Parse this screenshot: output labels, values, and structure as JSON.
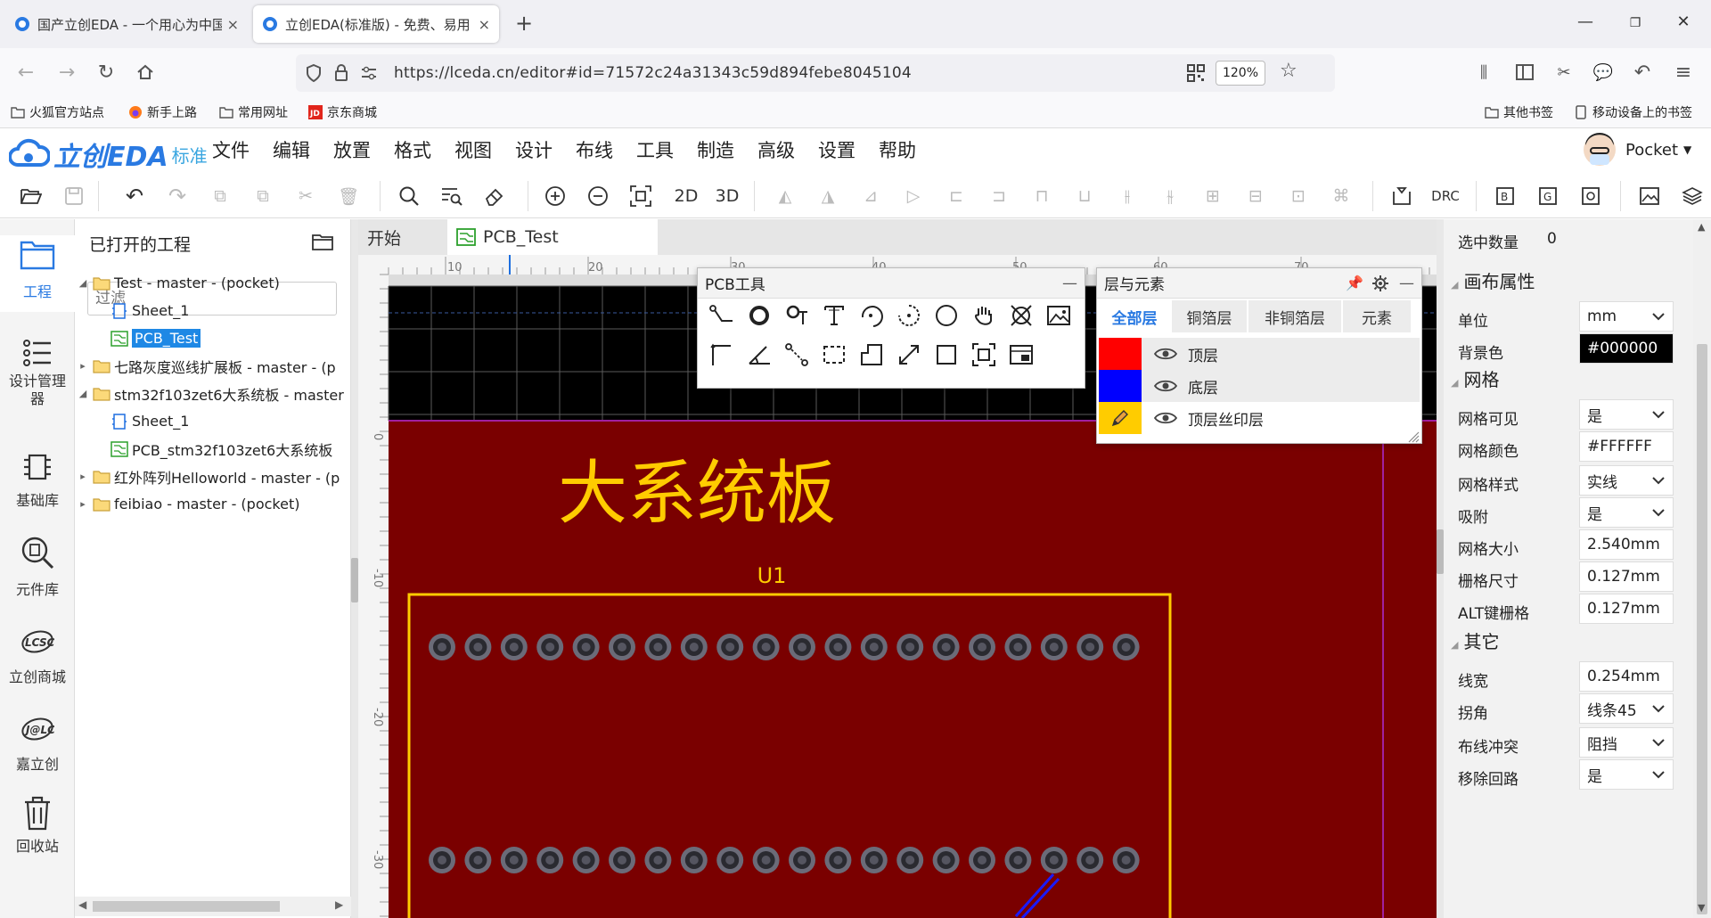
{
  "browser": {
    "tabs": [
      {
        "label": "国产立创EDA - 一个用心为中国",
        "close": "×"
      },
      {
        "label": "立创EDA(标准版) - 免费、易用",
        "close": "×"
      }
    ],
    "new_tab": "+",
    "url": "https://lceda.cn/editor#id=71572c24a31343c59d894febe8045104",
    "zoom": "120%",
    "bookmarks_left": [
      "火狐官方站点",
      "新手上路",
      "常用网址",
      "京东商城"
    ],
    "bookmarks_right": [
      "其他书签",
      "移动设备上的书签"
    ]
  },
  "app": {
    "logo_text": "立创EDA",
    "logo_sub": "标准",
    "menu": [
      "文件",
      "编辑",
      "放置",
      "格式",
      "视图",
      "设计",
      "布线",
      "工具",
      "制造",
      "高级",
      "设置",
      "帮助"
    ],
    "user": "Pocket",
    "toolbar_text": {
      "d2": "2D",
      "d3": "3D",
      "drc": "DRC"
    }
  },
  "left_rail": [
    {
      "label": "工程",
      "icon": "folder-icon"
    },
    {
      "label": "设计管理器",
      "icon": "list-icon"
    },
    {
      "label": "基础库",
      "icon": "chip-icon"
    },
    {
      "label": "元件库",
      "icon": "search-chip-icon"
    },
    {
      "label": "立创商城",
      "icon": "lcsc-icon"
    },
    {
      "label": "嘉立创",
      "icon": "jlc-icon"
    },
    {
      "label": "回收站",
      "icon": "trash-icon"
    }
  ],
  "project_panel": {
    "title": "已打开的工程",
    "filter_placeholder": "过滤",
    "tree": [
      {
        "label": "Test - master - (pocket)",
        "indent": 0,
        "type": "folder",
        "arrow": "◢"
      },
      {
        "label": "Sheet_1",
        "indent": 1,
        "type": "sch",
        "arrow": ""
      },
      {
        "label": "PCB_Test",
        "indent": 1,
        "type": "pcb",
        "arrow": "",
        "selected": true
      },
      {
        "label": "七路灰度巡线扩展板 - master - (p",
        "indent": 0,
        "type": "folder",
        "arrow": "▸"
      },
      {
        "label": "stm32f103zet6大系统板 - master",
        "indent": 0,
        "type": "folder",
        "arrow": "◢"
      },
      {
        "label": "Sheet_1",
        "indent": 1,
        "type": "sch",
        "arrow": ""
      },
      {
        "label": "PCB_stm32f103zet6大系统板",
        "indent": 1,
        "type": "pcb",
        "arrow": ""
      },
      {
        "label": "红外阵列Helloworld - master - (p",
        "indent": 0,
        "type": "folder",
        "arrow": "▸"
      },
      {
        "label": "feibiao - master - (pocket)",
        "indent": 0,
        "type": "folder",
        "arrow": "▸"
      }
    ]
  },
  "doc_tabs": [
    "开始",
    "PCB_Test"
  ],
  "canvas": {
    "ruler_top": [
      "10",
      "20",
      "30",
      "40",
      "50",
      "60",
      "70"
    ],
    "ruler_left": [
      "0",
      "-10",
      "-20",
      "-30"
    ],
    "board_title": "大系统板",
    "designator": "U1",
    "pads_per_row": 20,
    "board_color": "#7a0000",
    "silk_color": "#ffcc00"
  },
  "pcb_tools": {
    "title": "PCB工具",
    "minimize": "—"
  },
  "layers_panel": {
    "title": "层与元素",
    "minimize": "—",
    "tabs": [
      "全部层",
      "铜箔层",
      "非铜箔层",
      "元素"
    ],
    "layers": [
      {
        "name": "顶层",
        "color": "#ff0000"
      },
      {
        "name": "底层",
        "color": "#0000ff"
      },
      {
        "name": "顶层丝印层",
        "color": "#ffcc00"
      }
    ]
  },
  "properties": {
    "selected_count_label": "选中数量",
    "selected_count": "0",
    "canvas_section": "画布属性",
    "unit_label": "单位",
    "unit": "mm",
    "bg_label": "背景色",
    "bg": "#000000",
    "grid_section": "网格",
    "grid_visible_label": "网格可见",
    "grid_visible": "是",
    "grid_color_label": "网格颜色",
    "grid_color": "#FFFFFF",
    "grid_style_label": "网格样式",
    "grid_style": "实线",
    "snap_label": "吸附",
    "snap": "是",
    "grid_size_label": "网格大小",
    "grid_size": "2.540mm",
    "snap_size_label": "栅格尺寸",
    "snap_size": "0.127mm",
    "alt_snap_label": "ALT键栅格",
    "alt_snap": "0.127mm",
    "other_section": "其它",
    "line_width_label": "线宽",
    "line_width": "0.254mm",
    "corner_label": "拐角",
    "corner": "线条45",
    "conflict_label": "布线冲突",
    "conflict": "阻挡",
    "loop_label": "移除回路",
    "loop": "是"
  }
}
